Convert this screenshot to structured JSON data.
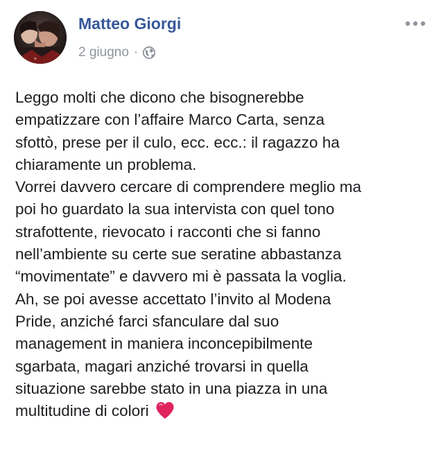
{
  "post": {
    "author": {
      "name": "Matteo Giorgi",
      "avatar_icon": "profile-photo"
    },
    "date": "2 giugno",
    "separator": "·",
    "audience_icon": "globe-icon",
    "more_icon": "more-options-icon",
    "body_lines": [
      "Leggo molti che dicono che bisognerebbe",
      "empatizzare con l’affaire Marco Carta, senza",
      "sfottò, prese per il culo, ecc. ecc.: il ragazzo ha",
      "chiaramente un problema.",
      "Vorrei davvero cercare di comprendere meglio ma",
      "poi ho guardato la sua intervista con quel tono",
      "strafottente, rievocato i racconti che si fanno",
      "nell’ambiente su certe sue seratine abbastanza",
      "“movimentate” e davvero mi è passata la voglia.",
      "Ah, se poi avesse accettato l’invito al Modena",
      "Pride, anziché farci sfanculare dal suo",
      "management in maniera inconcepibilmente",
      "sgarbata, magari anziché trovarsi in quella",
      "situazione sarebbe stato in una piazza in una",
      "multitudine di colori"
    ],
    "trailing_emoji": "red-heart-emoji"
  },
  "colors": {
    "author_name": "#365899",
    "meta_text": "#90949c",
    "body_text": "#1c1e21",
    "heart": "#e0245e",
    "background": "#ffffff"
  }
}
